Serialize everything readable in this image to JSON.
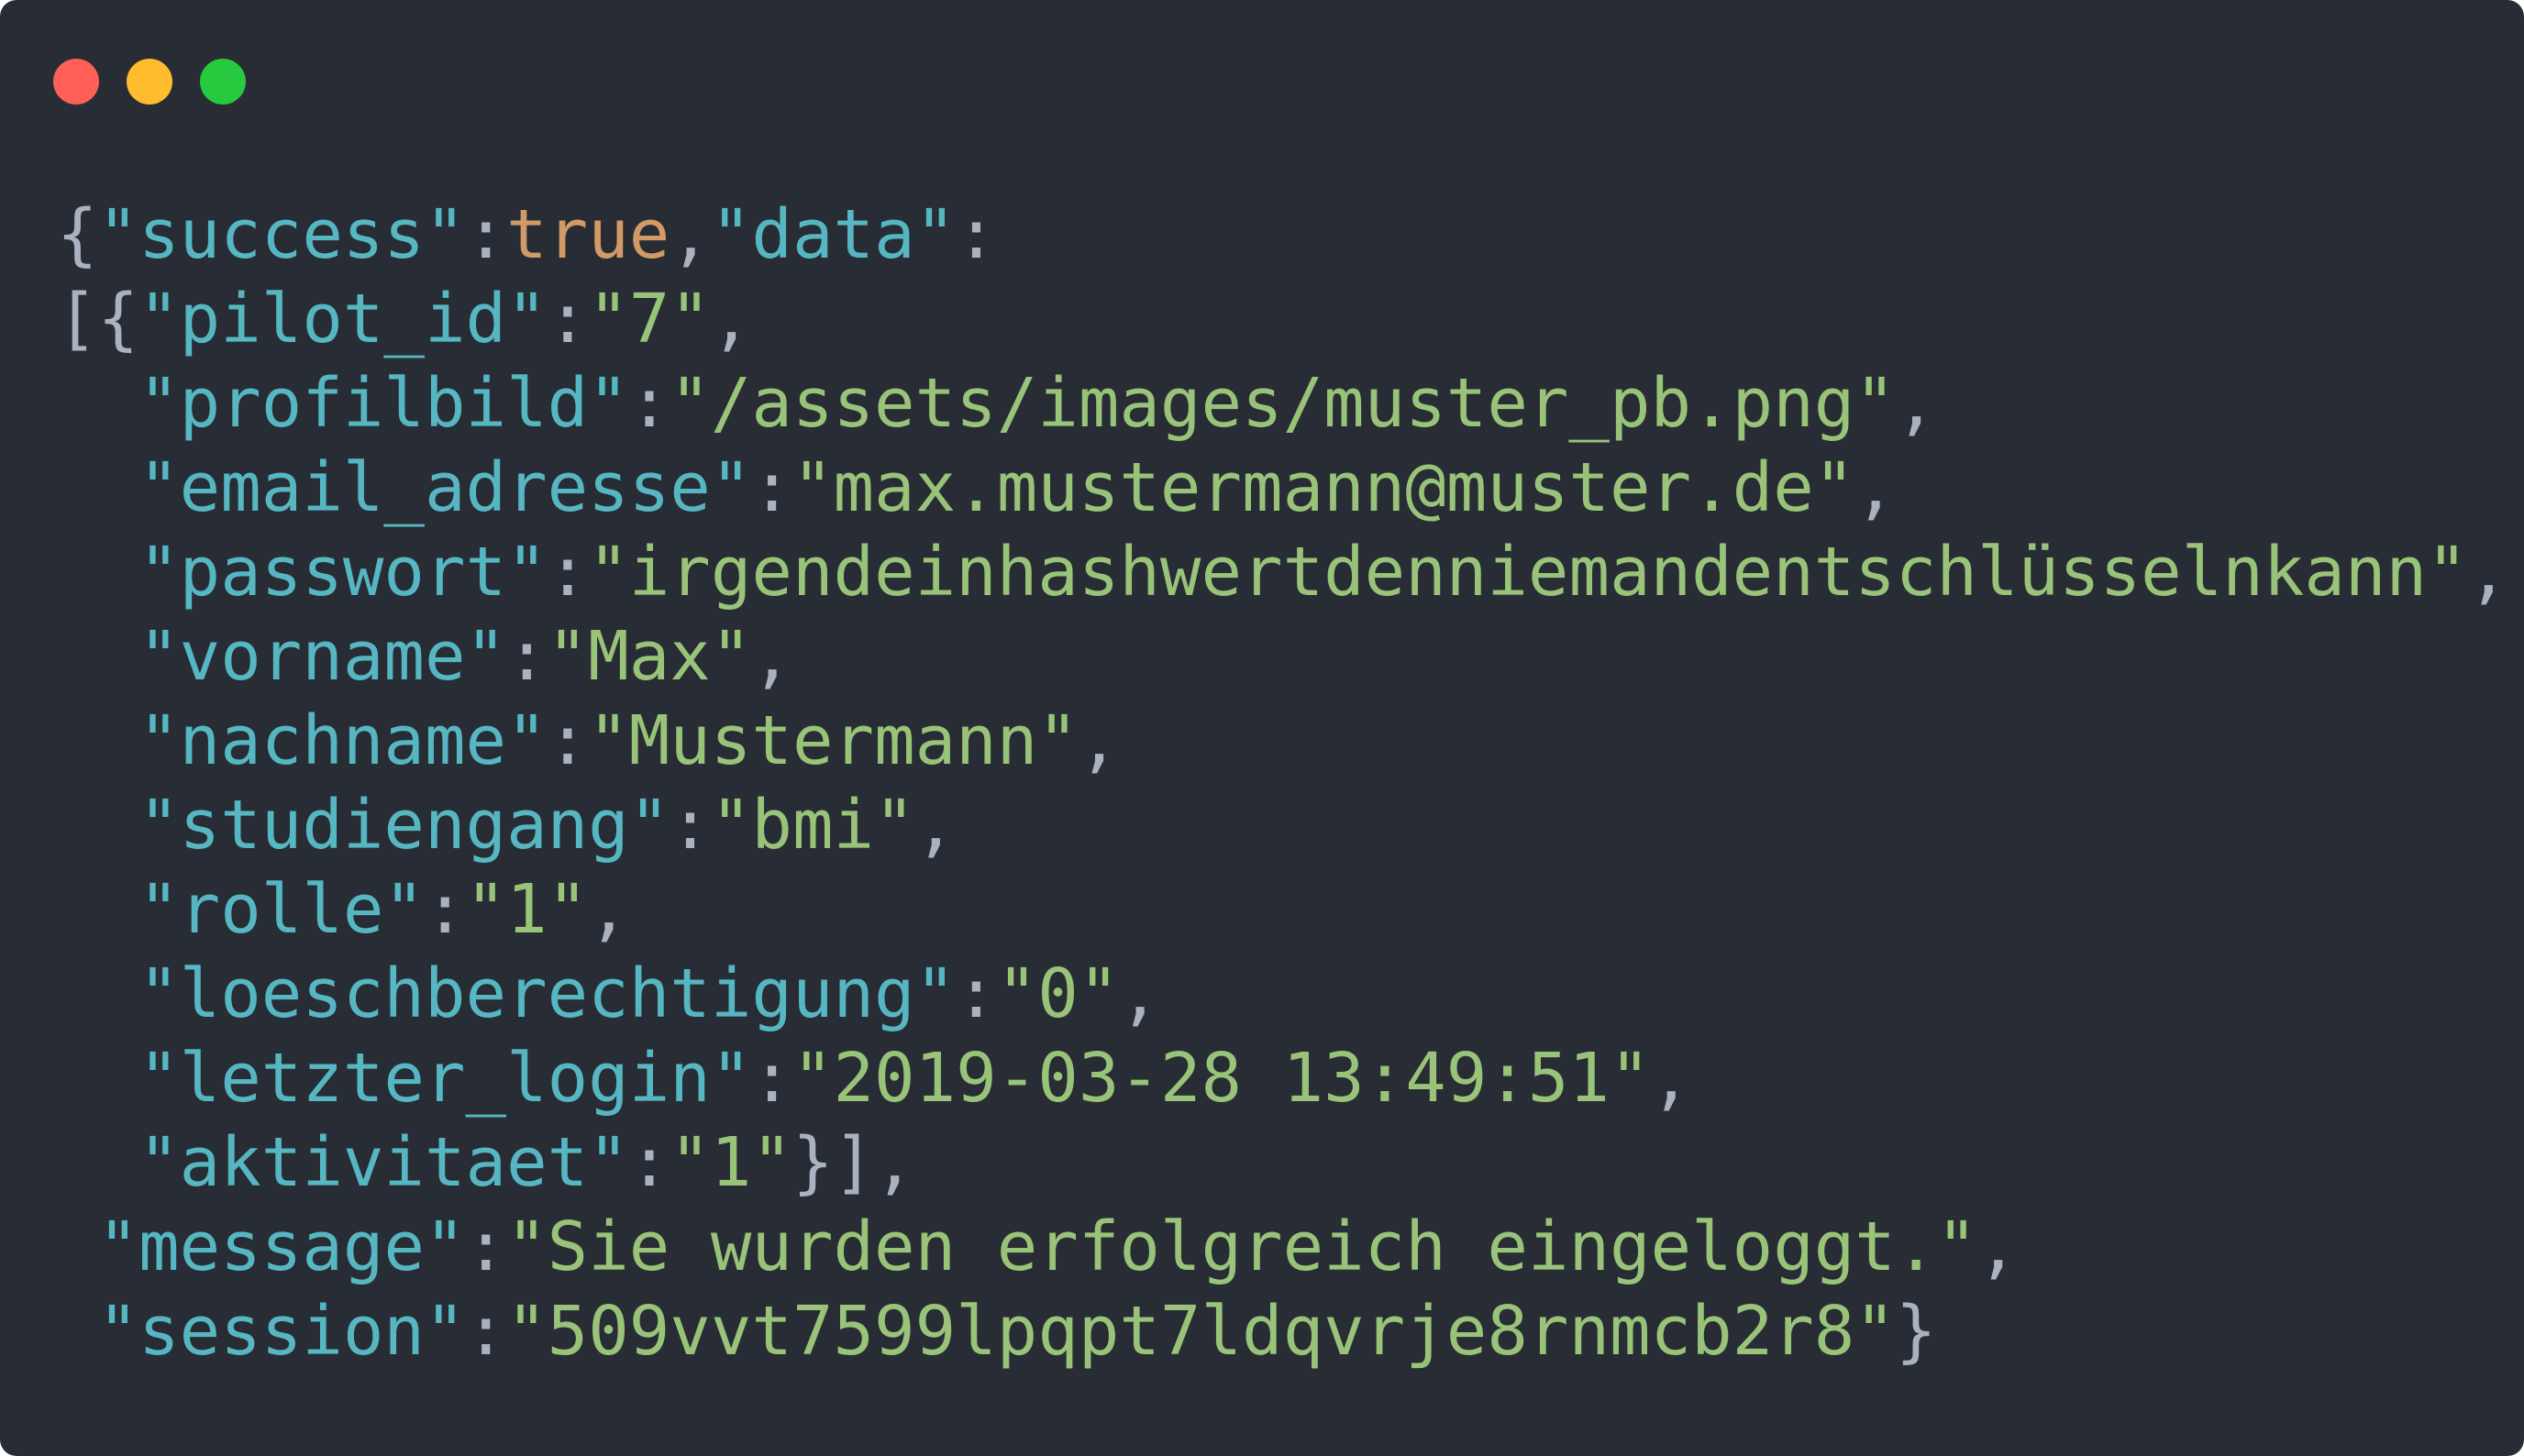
{
  "colors": {
    "background": "#282c34",
    "close": "#ff5f56",
    "minimize": "#ffbd2e",
    "zoom": "#27c93f",
    "punctuation": "#abb2bf",
    "key": "#56b6c2",
    "string": "#98c379",
    "boolean": "#d19a66"
  },
  "window_controls": [
    "close-button",
    "minimize-button",
    "zoom-button"
  ],
  "code": {
    "lines": [
      {
        "indent": "",
        "tokens": [
          {
            "t": "p",
            "v": "{"
          },
          {
            "t": "k",
            "v": "\"success\""
          },
          {
            "t": "p",
            "v": ":"
          },
          {
            "t": "b",
            "v": "true"
          },
          {
            "t": "p",
            "v": ","
          },
          {
            "t": "k",
            "v": "\"data\""
          },
          {
            "t": "p",
            "v": ":"
          }
        ]
      },
      {
        "indent": "",
        "tokens": [
          {
            "t": "p",
            "v": "[{"
          },
          {
            "t": "k",
            "v": "\"pilot_id\""
          },
          {
            "t": "p",
            "v": ":"
          },
          {
            "t": "s",
            "v": "\"7\""
          },
          {
            "t": "p",
            "v": ","
          }
        ]
      },
      {
        "indent": "  ",
        "tokens": [
          {
            "t": "k",
            "v": "\"profilbild\""
          },
          {
            "t": "p",
            "v": ":"
          },
          {
            "t": "s",
            "v": "\"/assets/images/muster_pb.png\""
          },
          {
            "t": "p",
            "v": ","
          }
        ]
      },
      {
        "indent": "  ",
        "tokens": [
          {
            "t": "k",
            "v": "\"email_adresse\""
          },
          {
            "t": "p",
            "v": ":"
          },
          {
            "t": "s",
            "v": "\"max.mustermann@muster.de\""
          },
          {
            "t": "p",
            "v": ","
          }
        ]
      },
      {
        "indent": "  ",
        "tokens": [
          {
            "t": "k",
            "v": "\"passwort\""
          },
          {
            "t": "p",
            "v": ":"
          },
          {
            "t": "s",
            "v": "\"irgendeinhashwertdenniemandentschlüsselnkann\""
          },
          {
            "t": "p",
            "v": ","
          }
        ]
      },
      {
        "indent": "  ",
        "tokens": [
          {
            "t": "k",
            "v": "\"vorname\""
          },
          {
            "t": "p",
            "v": ":"
          },
          {
            "t": "s",
            "v": "\"Max\""
          },
          {
            "t": "p",
            "v": ","
          }
        ]
      },
      {
        "indent": "  ",
        "tokens": [
          {
            "t": "k",
            "v": "\"nachname\""
          },
          {
            "t": "p",
            "v": ":"
          },
          {
            "t": "s",
            "v": "\"Mustermann\""
          },
          {
            "t": "p",
            "v": ","
          }
        ]
      },
      {
        "indent": "  ",
        "tokens": [
          {
            "t": "k",
            "v": "\"studiengang\""
          },
          {
            "t": "p",
            "v": ":"
          },
          {
            "t": "s",
            "v": "\"bmi\""
          },
          {
            "t": "p",
            "v": ","
          }
        ]
      },
      {
        "indent": "  ",
        "tokens": [
          {
            "t": "k",
            "v": "\"rolle\""
          },
          {
            "t": "p",
            "v": ":"
          },
          {
            "t": "s",
            "v": "\"1\""
          },
          {
            "t": "p",
            "v": ","
          }
        ]
      },
      {
        "indent": "  ",
        "tokens": [
          {
            "t": "k",
            "v": "\"loeschberechtigung\""
          },
          {
            "t": "p",
            "v": ":"
          },
          {
            "t": "s",
            "v": "\"0\""
          },
          {
            "t": "p",
            "v": ","
          }
        ]
      },
      {
        "indent": "  ",
        "tokens": [
          {
            "t": "k",
            "v": "\"letzter_login\""
          },
          {
            "t": "p",
            "v": ":"
          },
          {
            "t": "s",
            "v": "\"2019-03-28 13:49:51\""
          },
          {
            "t": "p",
            "v": ","
          }
        ]
      },
      {
        "indent": "  ",
        "tokens": [
          {
            "t": "k",
            "v": "\"aktivitaet\""
          },
          {
            "t": "p",
            "v": ":"
          },
          {
            "t": "s",
            "v": "\"1\""
          },
          {
            "t": "p",
            "v": "}],"
          }
        ]
      },
      {
        "indent": " ",
        "tokens": [
          {
            "t": "k",
            "v": "\"message\""
          },
          {
            "t": "p",
            "v": ":"
          },
          {
            "t": "s",
            "v": "\"Sie wurden erfolgreich eingeloggt.\""
          },
          {
            "t": "p",
            "v": ","
          }
        ]
      },
      {
        "indent": " ",
        "tokens": [
          {
            "t": "k",
            "v": "\"session\""
          },
          {
            "t": "p",
            "v": ":"
          },
          {
            "t": "s",
            "v": "\"509vvt7599lpqpt7ldqvrje8rnmcb2r8\""
          },
          {
            "t": "p",
            "v": "}"
          }
        ]
      }
    ]
  }
}
